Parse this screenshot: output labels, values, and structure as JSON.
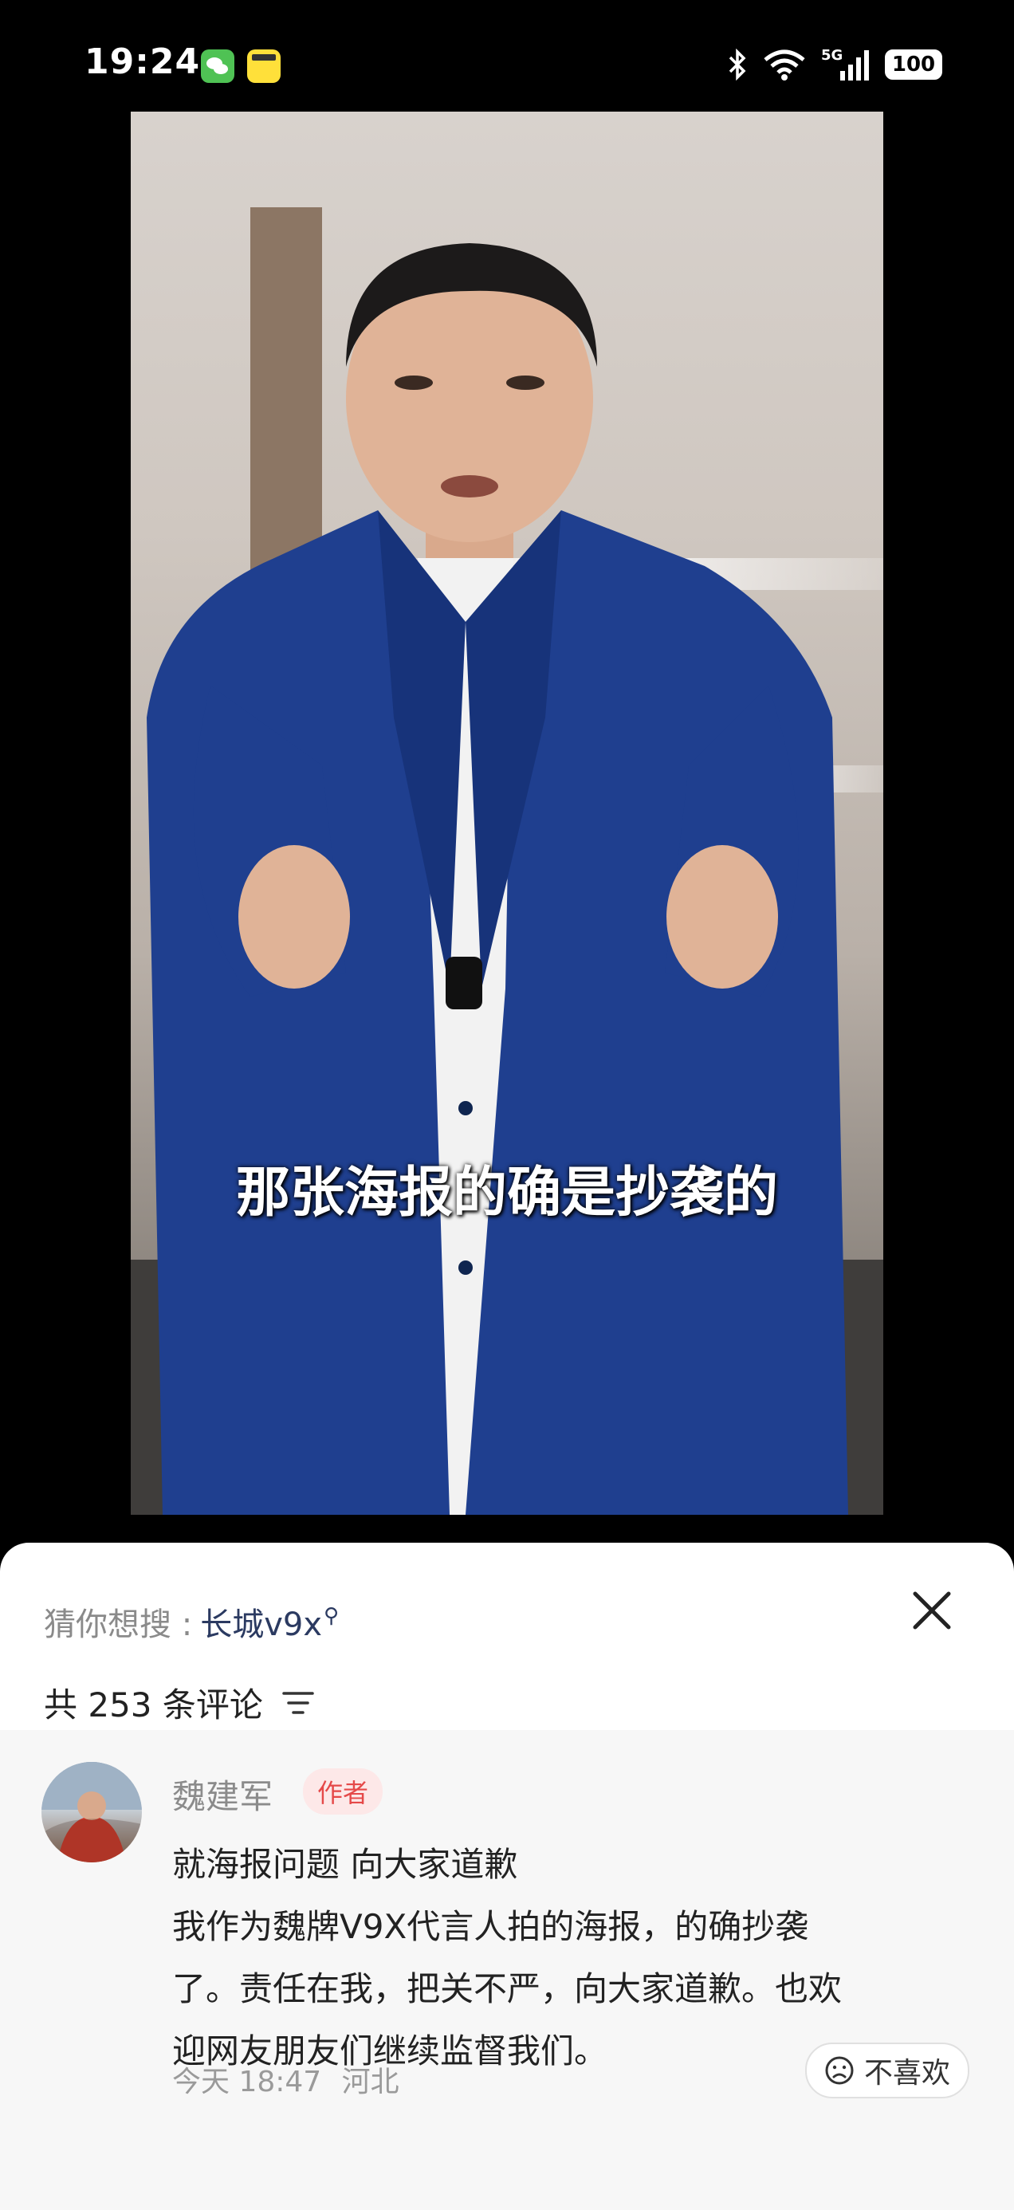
{
  "status_bar": {
    "time": "19:24",
    "network": "5G",
    "battery": "100",
    "icons": [
      "wechat-icon",
      "xianyu-icon",
      "bluetooth-icon",
      "wifi-icon",
      "signal-icon",
      "battery-icon"
    ]
  },
  "video": {
    "subtitle": "那张海报的确是抄袭的"
  },
  "comment_sheet": {
    "suggest_label": "猜你想搜 : ",
    "suggest_keyword": "长城v9x",
    "comment_count_text": "共 253 条评论",
    "comments": [
      {
        "author": "魏建军",
        "badge": "作者",
        "lines": [
          "就海报问题 向大家道歉",
          "我作为魏牌V9X代言人拍的海报，的确抄袭",
          "了。责任在我，把关不严，向大家道歉。也欢",
          "迎网友朋友们继续监督我们。"
        ],
        "time": "今天 18:47",
        "location": "河北",
        "dislike_label": "不喜欢"
      }
    ]
  },
  "colors": {
    "keyword": "#2b3a61",
    "badge_bg": "#fde8e8",
    "badge_text": "#e54949",
    "suit": "#1f3f8f"
  }
}
